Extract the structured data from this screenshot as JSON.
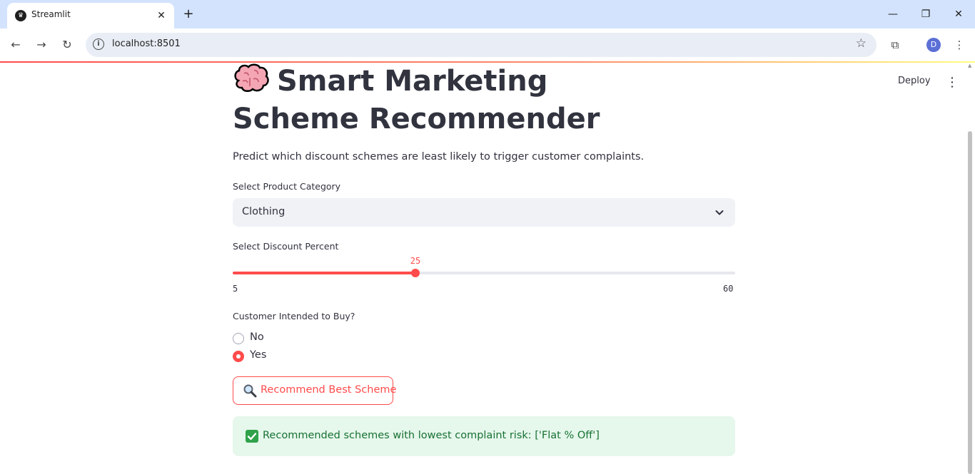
{
  "browser": {
    "tab_title": "Streamlit",
    "url": "localhost:8501",
    "profile_initial": "D"
  },
  "app": {
    "deploy_label": "Deploy",
    "title": "Smart Marketing Scheme Recommender",
    "title_icon": "brain-icon",
    "subtitle": "Predict which discount schemes are least likely to trigger customer complaints.",
    "category": {
      "label": "Select Product Category",
      "value": "Clothing"
    },
    "discount": {
      "label": "Select Discount Percent",
      "min": 5,
      "max": 60,
      "value": 25,
      "min_label": "5",
      "max_label": "60",
      "value_label": "25"
    },
    "intent": {
      "label": "Customer Intended to Buy?",
      "options": [
        "No",
        "Yes"
      ],
      "selected": "Yes"
    },
    "button": {
      "icon": "magnifier-icon",
      "label": "Recommend Best Scheme"
    },
    "result": {
      "icon": "check-mark-icon",
      "text": "Recommended schemes with lowest complaint risk: ['Flat % Off']"
    }
  },
  "colors": {
    "accent": "#ff4b4b",
    "text": "#31333f",
    "success_bg": "#e6f7ec",
    "success_text": "#177233"
  }
}
